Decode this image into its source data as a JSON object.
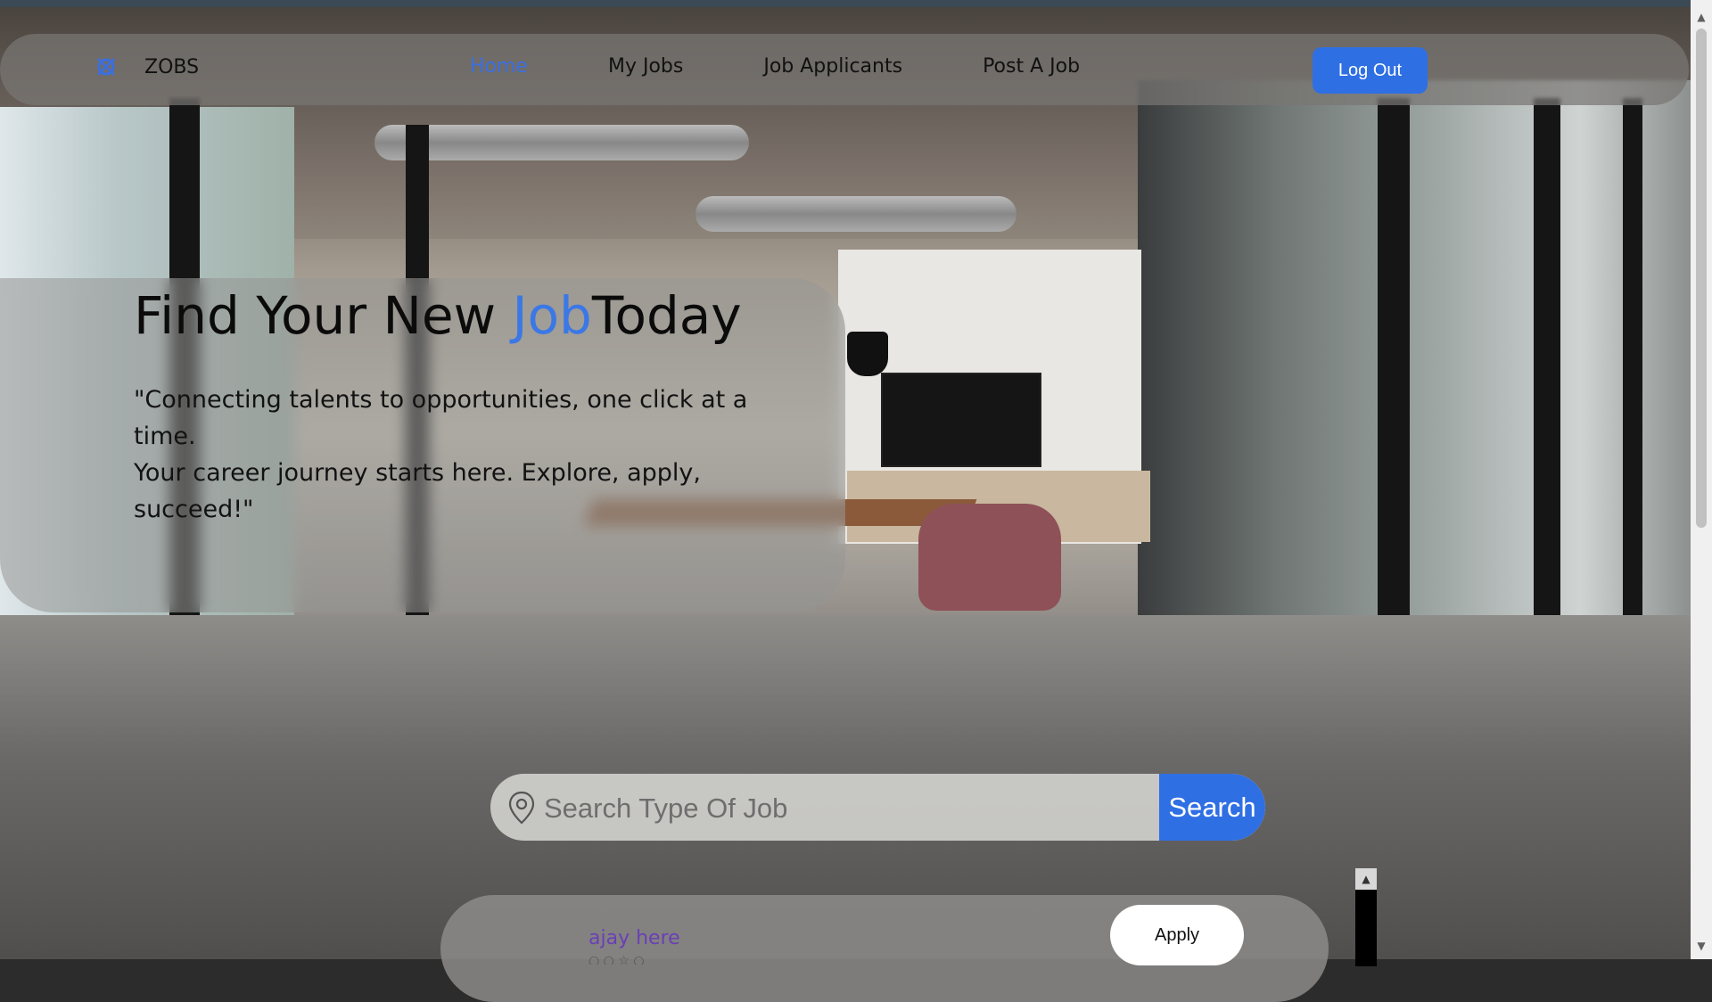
{
  "nav": {
    "brand": "ZOBS",
    "brand_icon": "logo-icon",
    "links": [
      "Home",
      "My Jobs",
      "Job Applicants",
      "Post A Job"
    ],
    "active_link": "Home",
    "logout_label": "Log Out"
  },
  "hero": {
    "title_part1": "Find Your New ",
    "title_accent": "Job",
    "title_part2": "Today",
    "quote_line1": "\"Connecting talents to opportunities, one click at a time.",
    "quote_line2": "Your career journey starts here. Explore, apply, succeed!\""
  },
  "search": {
    "placeholder": "Search Type Of Job",
    "icon": "location-pin-icon",
    "button_label": "Search"
  },
  "job_card": {
    "poster": "ajay here",
    "apply_label": "Apply"
  },
  "colors": {
    "accent": "#2f6fe4",
    "active_link": "#3b6fe0",
    "poster_link": "#6a3fb5"
  }
}
